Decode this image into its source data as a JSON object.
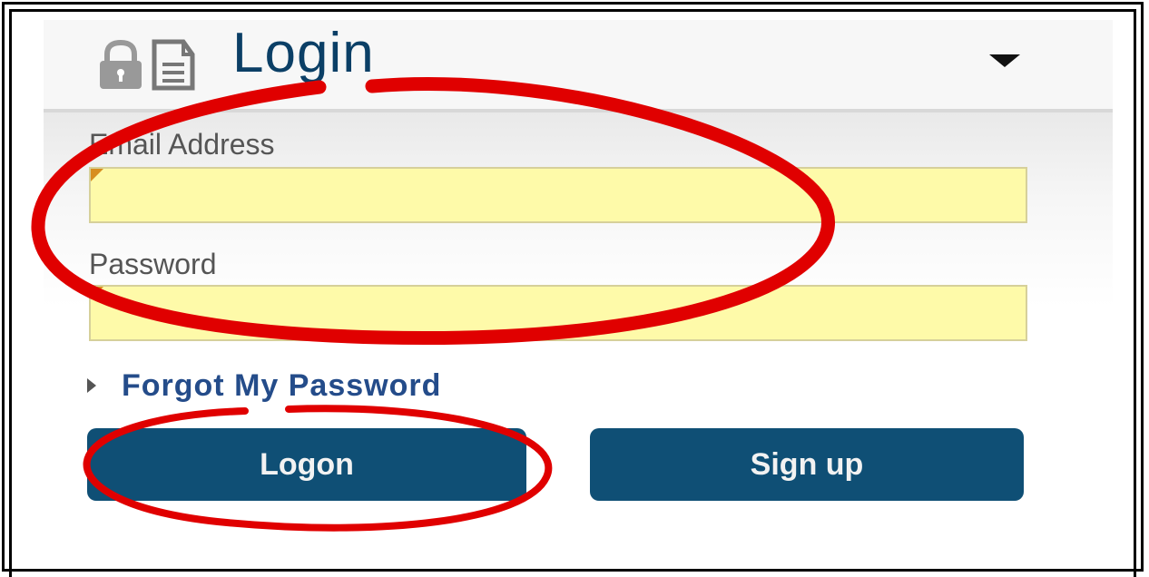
{
  "login": {
    "title": "Login",
    "icons": {
      "header_icon": "lock-document-icon",
      "menu_toggle": "caret-down-icon",
      "forgot_marker": "triangle-right-icon"
    },
    "email": {
      "label": "Email Address",
      "value": "",
      "placeholder": ""
    },
    "password": {
      "label": "Password",
      "value": "",
      "placeholder": ""
    },
    "forgot_link": "Forgot My Password",
    "buttons": {
      "logon": "Logon",
      "signup": "Sign up"
    },
    "colors": {
      "title": "#0b3f66",
      "button": "#0f4f75",
      "input_bg": "#fefaa9",
      "link": "#244c8a",
      "annotation": "#e00000"
    }
  }
}
